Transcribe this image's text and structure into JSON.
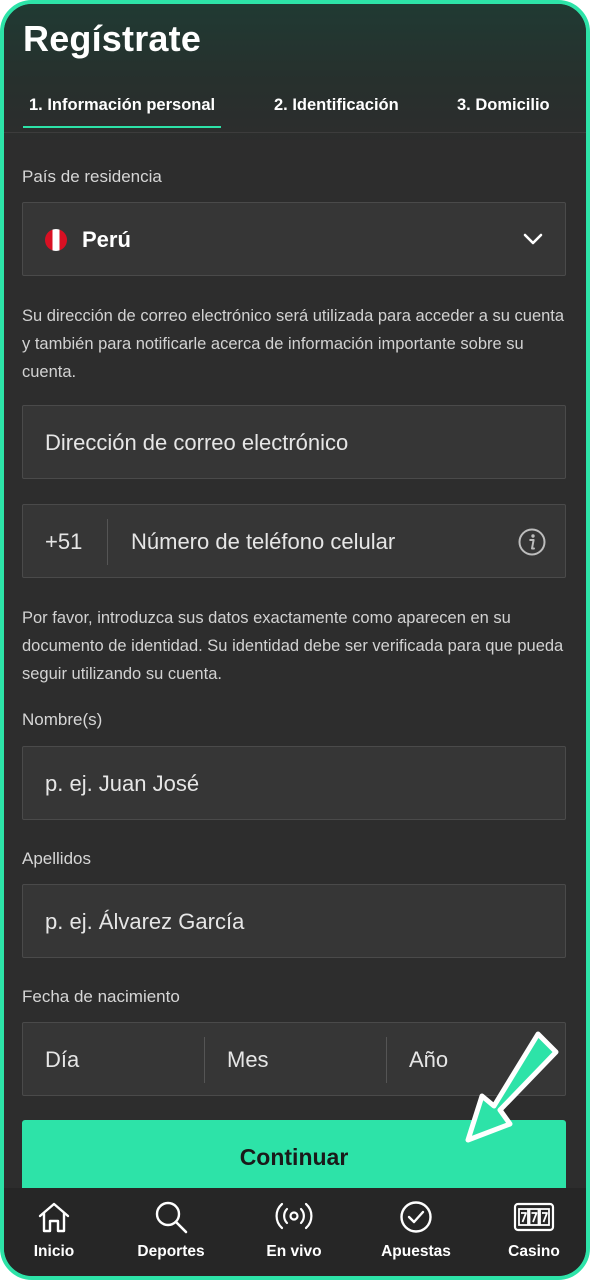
{
  "page": {
    "title": "Regístrate"
  },
  "tabs": [
    {
      "label": "1. Información personal",
      "active": true
    },
    {
      "label": "2. Identificación",
      "active": false
    },
    {
      "label": "3. Domicilio",
      "active": false
    }
  ],
  "residence": {
    "label": "País de residencia",
    "value": "Perú",
    "flag_icon": "peru-flag-icon"
  },
  "email": {
    "helper": "Su dirección de correo electrónico será utilizada para acceder a su cuenta y también para notificarle acerca de información importante sobre su cuenta.",
    "placeholder": "Dirección de correo electrónico"
  },
  "phone": {
    "prefix": "+51",
    "placeholder": "Número de teléfono celular"
  },
  "identity": {
    "helper": "Por favor, introduzca sus datos exactamente como aparecen en su documento de identidad. Su identidad debe ser verificada para que pueda seguir utilizando su cuenta."
  },
  "first_name": {
    "label": "Nombre(s)",
    "placeholder": "p. ej. Juan José"
  },
  "last_name": {
    "label": "Apellidos",
    "placeholder": "p. ej. Álvarez García"
  },
  "birth_date": {
    "label": "Fecha de nacimiento",
    "day": "Día",
    "month": "Mes",
    "year": "Año"
  },
  "continue_label": "Continuar",
  "nav": [
    {
      "label": "Inicio",
      "icon": "home-icon"
    },
    {
      "label": "Deportes",
      "icon": "search-icon"
    },
    {
      "label": "En vivo",
      "icon": "live-icon"
    },
    {
      "label": "Apuestas",
      "icon": "check-circle-icon"
    },
    {
      "label": "Casino",
      "icon": "slot-machine-icon"
    }
  ],
  "colors": {
    "accent": "#2de3a8",
    "background": "#2d2d2d",
    "nav": "#262626",
    "flag_red": "#d91023"
  }
}
